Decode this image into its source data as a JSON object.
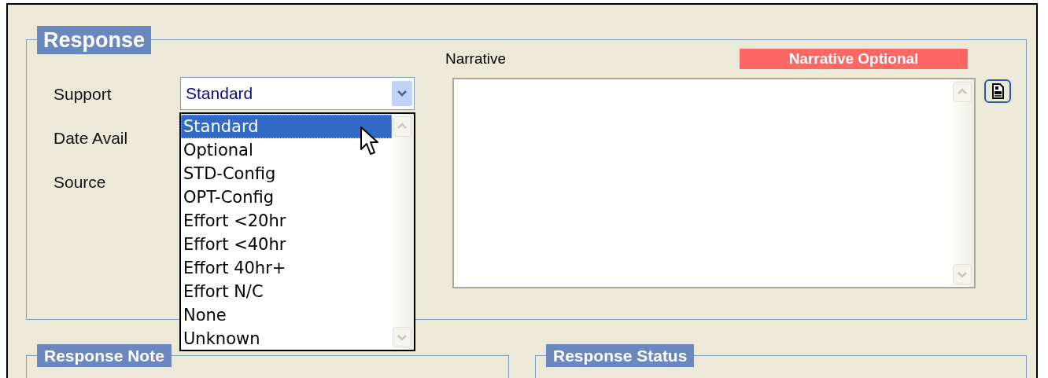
{
  "response": {
    "title": "Response",
    "fields": [
      {
        "label": "Support"
      },
      {
        "label": "Date Avail"
      },
      {
        "label": "Source"
      }
    ],
    "support_select": {
      "value": "Standard",
      "expanded": true
    },
    "support_options": [
      {
        "label": "Standard",
        "selected": true
      },
      {
        "label": "Optional",
        "selected": false
      },
      {
        "label": "STD-Config",
        "selected": false
      },
      {
        "label": "OPT-Config",
        "selected": false
      },
      {
        "label": "Effort <20hr",
        "selected": false
      },
      {
        "label": "Effort <40hr",
        "selected": false
      },
      {
        "label": "Effort 40hr+",
        "selected": false
      },
      {
        "label": "Effort N/C",
        "selected": false
      },
      {
        "label": "None",
        "selected": false
      },
      {
        "label": "Unknown",
        "selected": false
      }
    ],
    "narrative_label": "Narrative",
    "narrative_badge": "Narrative Optional"
  },
  "sections": [
    {
      "title": "Response Note"
    },
    {
      "title": "Response Status"
    }
  ]
}
